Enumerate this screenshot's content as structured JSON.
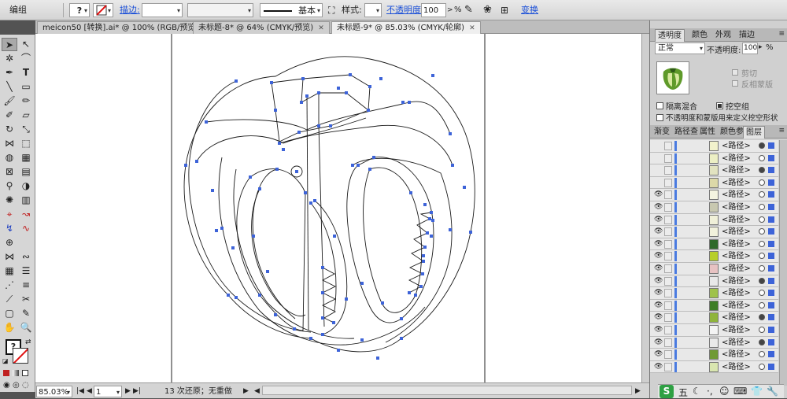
{
  "control_bar": {
    "mode_label": "编组",
    "question_mark": "?",
    "stroke_label": "描边:",
    "stroke_style": "基本",
    "style_label": "样式:",
    "opacity_label": "不透明度:",
    "opacity_value": "100",
    "opacity_unit": "%",
    "transform_label": "变换"
  },
  "document_tabs": [
    {
      "label": "meicon50 [转换].ai* @ 100% (RGB/预览)",
      "active": false
    },
    {
      "label": "未标题-8* @ 64% (CMYK/预览)",
      "active": false
    },
    {
      "label": "未标题-9* @ 85.03% (CMYK/轮廓)",
      "active": true
    }
  ],
  "status_bar": {
    "zoom": "85.03%",
    "page": "1",
    "status_text": "13 次还原；无重做"
  },
  "transparency_panel": {
    "tabs": [
      "透明度",
      "颜色",
      "外观",
      "描边"
    ],
    "blend_mode": "正常",
    "opacity_label": "不透明度:",
    "opacity_value": "100",
    "opacity_unit": "%",
    "clip_label": "剪切",
    "invert_mask_label": "反相蒙版",
    "isolate_blending_label": "隔离混合",
    "knockout_group_label": "挖空组",
    "opacity_mask_label": "不透明度和蒙版用来定义挖空形状"
  },
  "layers_panel": {
    "tabs": [
      "渐变",
      "路径查",
      "属性",
      "颜色参",
      "图层"
    ],
    "rows": [
      {
        "label": "<路径>",
        "visible": false,
        "thumb": "#f2f2cc",
        "target_filled": true
      },
      {
        "label": "<路径>",
        "visible": false,
        "thumb": "#ecefc4",
        "target_filled": false
      },
      {
        "label": "<路径>",
        "visible": false,
        "thumb": "#e2e3c0",
        "target_filled": true
      },
      {
        "label": "<路径>",
        "visible": false,
        "thumb": "#dcd8a8",
        "target_filled": false
      },
      {
        "label": "<路径>",
        "visible": true,
        "thumb": "#f4f4e0",
        "target_filled": false
      },
      {
        "label": "<路径>",
        "visible": true,
        "thumb": "#c8c8b0",
        "target_filled": false
      },
      {
        "label": "<路径>",
        "visible": true,
        "thumb": "#f0f0d8",
        "target_filled": false
      },
      {
        "label": "<路径>",
        "visible": true,
        "thumb": "#f2f2dc",
        "target_filled": false
      },
      {
        "label": "<路径>",
        "visible": true,
        "thumb": "#2f6a2a",
        "target_filled": false
      },
      {
        "label": "<路径>",
        "visible": true,
        "thumb": "#b7cf2a",
        "target_filled": false
      },
      {
        "label": "<路径>",
        "visible": true,
        "thumb": "#e7c2c2",
        "target_filled": false
      },
      {
        "label": "<路径>",
        "visible": true,
        "thumb": "#e8e8e8",
        "target_filled": true
      },
      {
        "label": "<路径>",
        "visible": true,
        "thumb": "#9fc24a",
        "target_filled": false
      },
      {
        "label": "<路径>",
        "visible": true,
        "thumb": "#3e7e26",
        "target_filled": false
      },
      {
        "label": "<路径>",
        "visible": true,
        "thumb": "#8fb43c",
        "target_filled": true
      },
      {
        "label": "<路径>",
        "visible": true,
        "thumb": "#f4f4f4",
        "target_filled": false
      },
      {
        "label": "<路径>",
        "visible": true,
        "thumb": "#e9e9e9",
        "target_filled": true
      },
      {
        "label": "<路径>",
        "visible": true,
        "thumb": "#6f9a34",
        "target_filled": false
      },
      {
        "label": "<路径>",
        "visible": true,
        "thumb": "#d9e6b0",
        "target_filled": false
      }
    ]
  },
  "colors": {
    "anchor_point": "#3d63d8",
    "selection_blue": "#3d63d8",
    "link_blue": "#1a4fd8"
  }
}
